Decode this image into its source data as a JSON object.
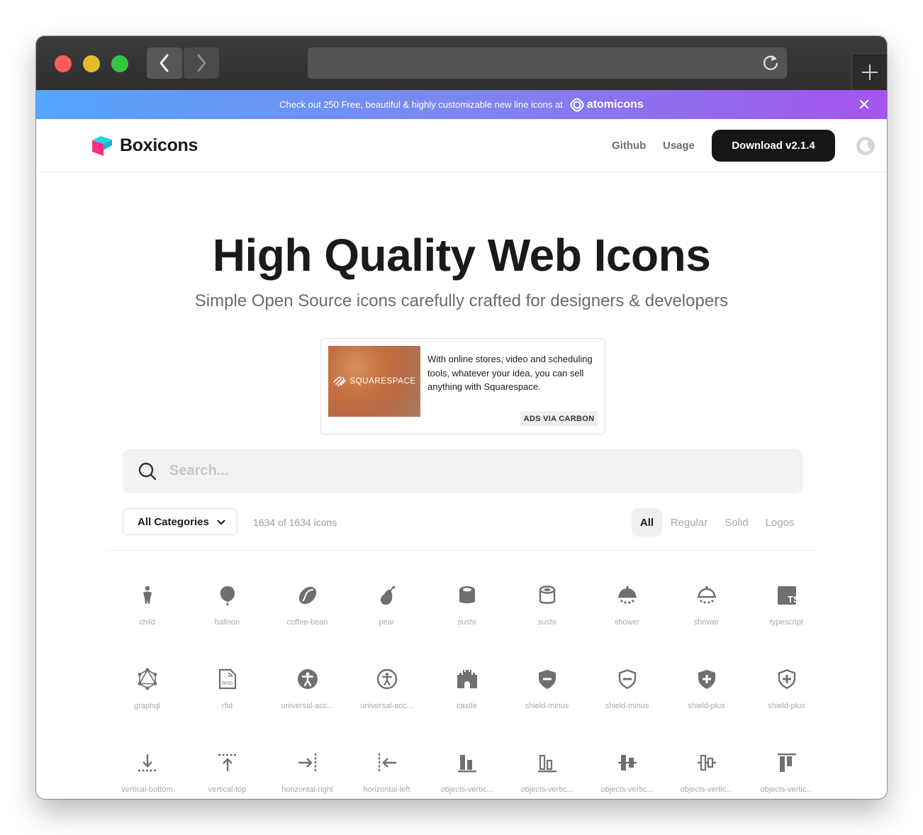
{
  "browser": {
    "back_icon": "chevron-left-icon",
    "forward_icon": "chevron-right-icon",
    "reload_icon": "reload-icon",
    "new_tab_icon": "plus-icon"
  },
  "banner": {
    "text": "Check out 250 Free, beautiful & highly customizable new line icons at",
    "link_label": "atomicons",
    "gradient": [
      "#54a6ff",
      "#a354ee"
    ]
  },
  "header": {
    "brand": "Boxicons",
    "nav": [
      "Github",
      "Usage"
    ],
    "download_label": "Download v2.1.4"
  },
  "hero": {
    "title": "High Quality Web Icons",
    "subtitle": "Simple Open Source icons carefully crafted for designers & developers"
  },
  "ad": {
    "image_label": "SQUARESPACE",
    "text": "With online stores, video and scheduling tools, whatever your idea, you can sell anything with Squarespace.",
    "tag": "ADS VIA CARBON"
  },
  "search": {
    "placeholder": "Search...",
    "value": ""
  },
  "toolbar": {
    "category_selected": "All Categories",
    "count_text": "1634 of 1634 icons",
    "filters": [
      "All",
      "Regular",
      "Solid",
      "Logos"
    ],
    "active_filter": "All"
  },
  "icons": [
    {
      "label": "child",
      "icon": "child-icon"
    },
    {
      "label": "balloon",
      "icon": "balloon-icon"
    },
    {
      "label": "coffee-bean",
      "icon": "coffee-bean-icon"
    },
    {
      "label": "pear",
      "icon": "pear-icon"
    },
    {
      "label": "sushi",
      "icon": "sushi-solid-icon"
    },
    {
      "label": "sushi",
      "icon": "sushi-regular-icon"
    },
    {
      "label": "shower",
      "icon": "shower-solid-icon"
    },
    {
      "label": "shower",
      "icon": "shower-regular-icon"
    },
    {
      "label": "typescript",
      "icon": "typescript-icon"
    },
    {
      "label": "graphql",
      "icon": "graphql-icon"
    },
    {
      "label": "rfid",
      "icon": "rfid-icon"
    },
    {
      "label": "universal-acc...",
      "icon": "universal-access-solid-icon"
    },
    {
      "label": "universal-acc...",
      "icon": "universal-access-regular-icon"
    },
    {
      "label": "castle",
      "icon": "castle-icon"
    },
    {
      "label": "shield-minus",
      "icon": "shield-minus-solid-icon"
    },
    {
      "label": "shield-minus",
      "icon": "shield-minus-regular-icon"
    },
    {
      "label": "shield-plus",
      "icon": "shield-plus-solid-icon"
    },
    {
      "label": "shield-plus",
      "icon": "shield-plus-regular-icon"
    },
    {
      "label": "vertical-bottom",
      "icon": "vertical-bottom-icon"
    },
    {
      "label": "vertical-top",
      "icon": "vertical-top-icon"
    },
    {
      "label": "horizontal-right",
      "icon": "horizontal-right-icon"
    },
    {
      "label": "horizontal-left",
      "icon": "horizontal-left-icon"
    },
    {
      "label": "objects-vertic...",
      "icon": "objects-vertical-bottom-solid-icon"
    },
    {
      "label": "objects-vertic...",
      "icon": "objects-vertical-bottom-regular-icon"
    },
    {
      "label": "objects-vertic...",
      "icon": "objects-vertical-center-solid-icon"
    },
    {
      "label": "objects-vertic...",
      "icon": "objects-vertical-center-regular-icon"
    },
    {
      "label": "objects-vertic...",
      "icon": "objects-vertical-top-solid-icon"
    }
  ],
  "colors": {
    "accent_dark": "#161616",
    "icon_gray": "#6f6f6f",
    "label_gray": "#a8a8a8"
  }
}
